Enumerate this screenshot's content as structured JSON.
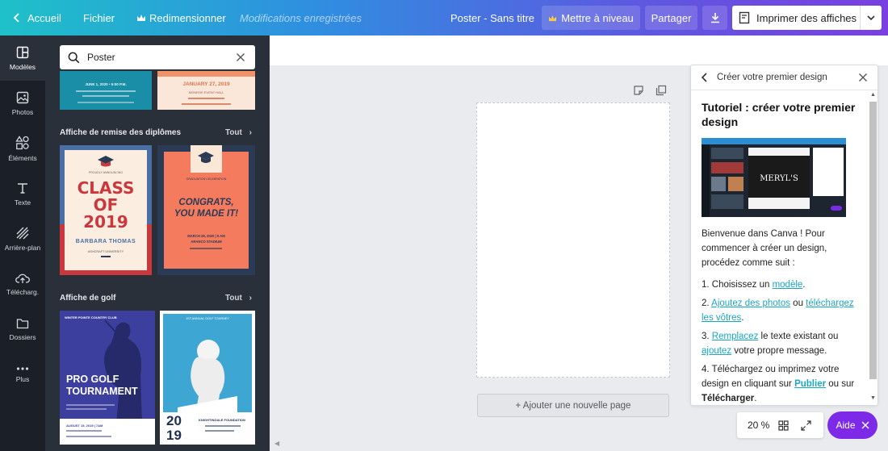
{
  "topbar": {
    "back_label": "Accueil",
    "file_label": "Fichier",
    "resize_label": "Redimensionner",
    "saved_status": "Modifications enregistrées",
    "doc_title": "Poster - Sans titre",
    "upgrade_label": "Mettre à niveau",
    "share_label": "Partager",
    "print_label": "Imprimer des affiches"
  },
  "rail": {
    "items": [
      {
        "label": "Modèles",
        "icon": "templates-icon"
      },
      {
        "label": "Photos",
        "icon": "photos-icon"
      },
      {
        "label": "Éléments",
        "icon": "elements-icon"
      },
      {
        "label": "Texte",
        "icon": "text-icon"
      },
      {
        "label": "Arrière-plan",
        "icon": "background-icon"
      },
      {
        "label": "Télécharg.",
        "icon": "upload-icon"
      },
      {
        "label": "Dossiers",
        "icon": "folder-icon"
      },
      {
        "label": "Plus",
        "icon": "more-icon"
      }
    ]
  },
  "panel": {
    "search_value": "Poster",
    "top_thumbs": {
      "left_line1": "JUNE 1, 2020 • 5:00 P.M.",
      "right_line1": "JANUARY 27, 2019",
      "right_line2": "MONROE EVENT HALL"
    },
    "sections": [
      {
        "title": "Affiche de remise des diplômes",
        "all_label": "Tout"
      },
      {
        "title": "Affiche de golf",
        "all_label": "Tout"
      }
    ],
    "grad1": {
      "title": "CLASS OF 2019",
      "line1": "CLASS",
      "line2": "OF",
      "line3": "2019",
      "name": "BARBARA THOMAS",
      "school": "ASHCRAFT UNIVERSITY"
    },
    "grad2": {
      "line1": "CONGRATS,",
      "line2": "YOU MADE IT!",
      "date": "MARCH 28, 2020 | 9 AM",
      "venue": "ARANCO STADIUM"
    },
    "golf1": {
      "header": "WINTER POINTE COUNTRY CLUB",
      "line1": "PRO GOLF",
      "line2": "TOURNAMENT",
      "footer": "AUGUST 15, 2019 | 7AM"
    },
    "golf2": {
      "header": "1ST ANNUAL GOLF TOURNEY",
      "year1": "20",
      "year2": "19",
      "org": "KNIGHTINGALE FOUNDATION"
    }
  },
  "canvas": {
    "add_page_label": "+ Ajouter une nouvelle page"
  },
  "help": {
    "header": "Créer votre premier design",
    "title": "Tutoriel : créer votre premier design",
    "preview_brand": "MERYL'S",
    "intro": "Bienvenue dans Canva ! Pour commencer à créer un design, procédez comme suit :",
    "step1_a": "1. Choisissez un ",
    "step1_link": "modèle",
    "step1_b": ".",
    "step2_a": "2. ",
    "step2_link1": "Ajoutez des photos",
    "step2_b": " ou ",
    "step2_link2": "téléchargez les vôtres",
    "step2_c": ".",
    "step3_a": "3. ",
    "step3_link1": "Remplacez",
    "step3_b": " le texte existant ou ",
    "step3_link2": "ajoutez",
    "step3_c": " votre propre message.",
    "step4_a": "4. Téléchargez ou imprimez votre design en cliquant sur ",
    "step4_link": "Publier",
    "step4_b": " ou sur ",
    "step4_bold": "Télécharger",
    "step4_c": "."
  },
  "zoom": {
    "value": "20 %"
  },
  "aide_label": "Aide",
  "colors": {
    "accent": "#7d2ae8",
    "link": "#19a7c2",
    "rail": "#1b2028",
    "panel": "#2a3039"
  }
}
